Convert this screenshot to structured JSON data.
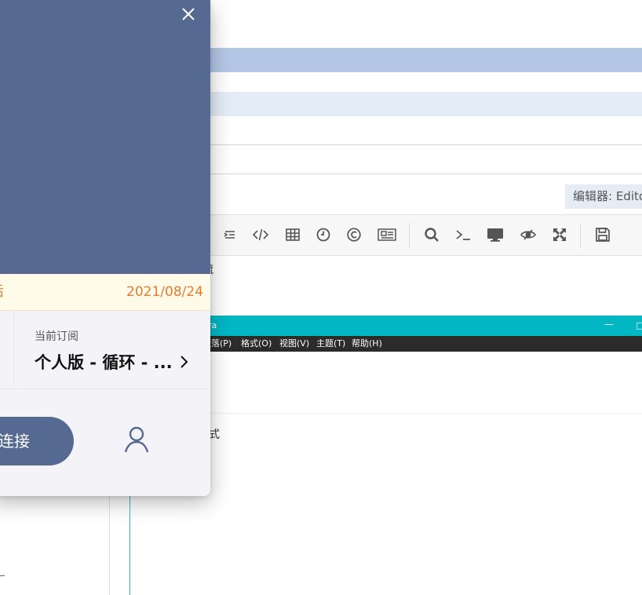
{
  "colors": {
    "brand": "#566991",
    "expiry_text": "#e67b2f",
    "expiry_bg": "#fefbe9",
    "typora_title_bg": "#00b7c3"
  },
  "popup": {
    "close_icon": "close-icon",
    "expiry": {
      "left_text": "后",
      "date": "2021/08/24"
    },
    "subscription": {
      "label": "当前订阅",
      "value": "个人版 - 循环 - ...",
      "chevron_icon": "chevron-right-icon"
    },
    "connect_label": "连接",
    "user_icon": "user-icon"
  },
  "editor": {
    "editor_select": "编辑器: Editor",
    "toolbar_icons": [
      "list-indent-icon",
      "code-icon",
      "table-icon",
      "clock-icon",
      "copyright-icon",
      "newspaper-icon",
      "search-icon",
      "terminal-icon",
      "monitor-icon",
      "preview-icon",
      "fullscreen-icon",
      "save-icon"
    ],
    "text_line1": "疏",
    "text_line2": "式"
  },
  "typora": {
    "title": "pra",
    "minimize": "—",
    "maximize": "□",
    "menu": [
      "段落(P)",
      "格式(O)",
      "视图(V)",
      "主题(T)",
      "帮助(H)"
    ]
  }
}
